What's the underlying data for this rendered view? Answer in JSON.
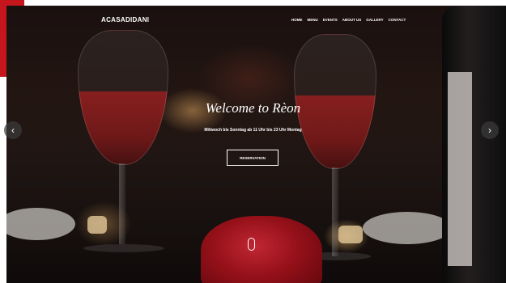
{
  "brand": {
    "logo_text": "ACASADIDANI"
  },
  "nav": {
    "items": [
      "HOME",
      "MENU",
      "EVENTS",
      "ABOUT US",
      "GALLERY",
      "CONTACT"
    ]
  },
  "hero": {
    "title": "Welcome to Rèon",
    "subtitle": "Mittwoch bis Sonntag ab 11 Uhr bis 23 Uhr Montag",
    "button_label": "RESERVATION"
  },
  "slider": {
    "prev_icon": "‹",
    "next_icon": "›"
  },
  "colors": {
    "accent": "#c4161c"
  },
  "icons": [
    "chevron-left-icon",
    "chevron-right-icon",
    "mouse-scroll-icon"
  ]
}
